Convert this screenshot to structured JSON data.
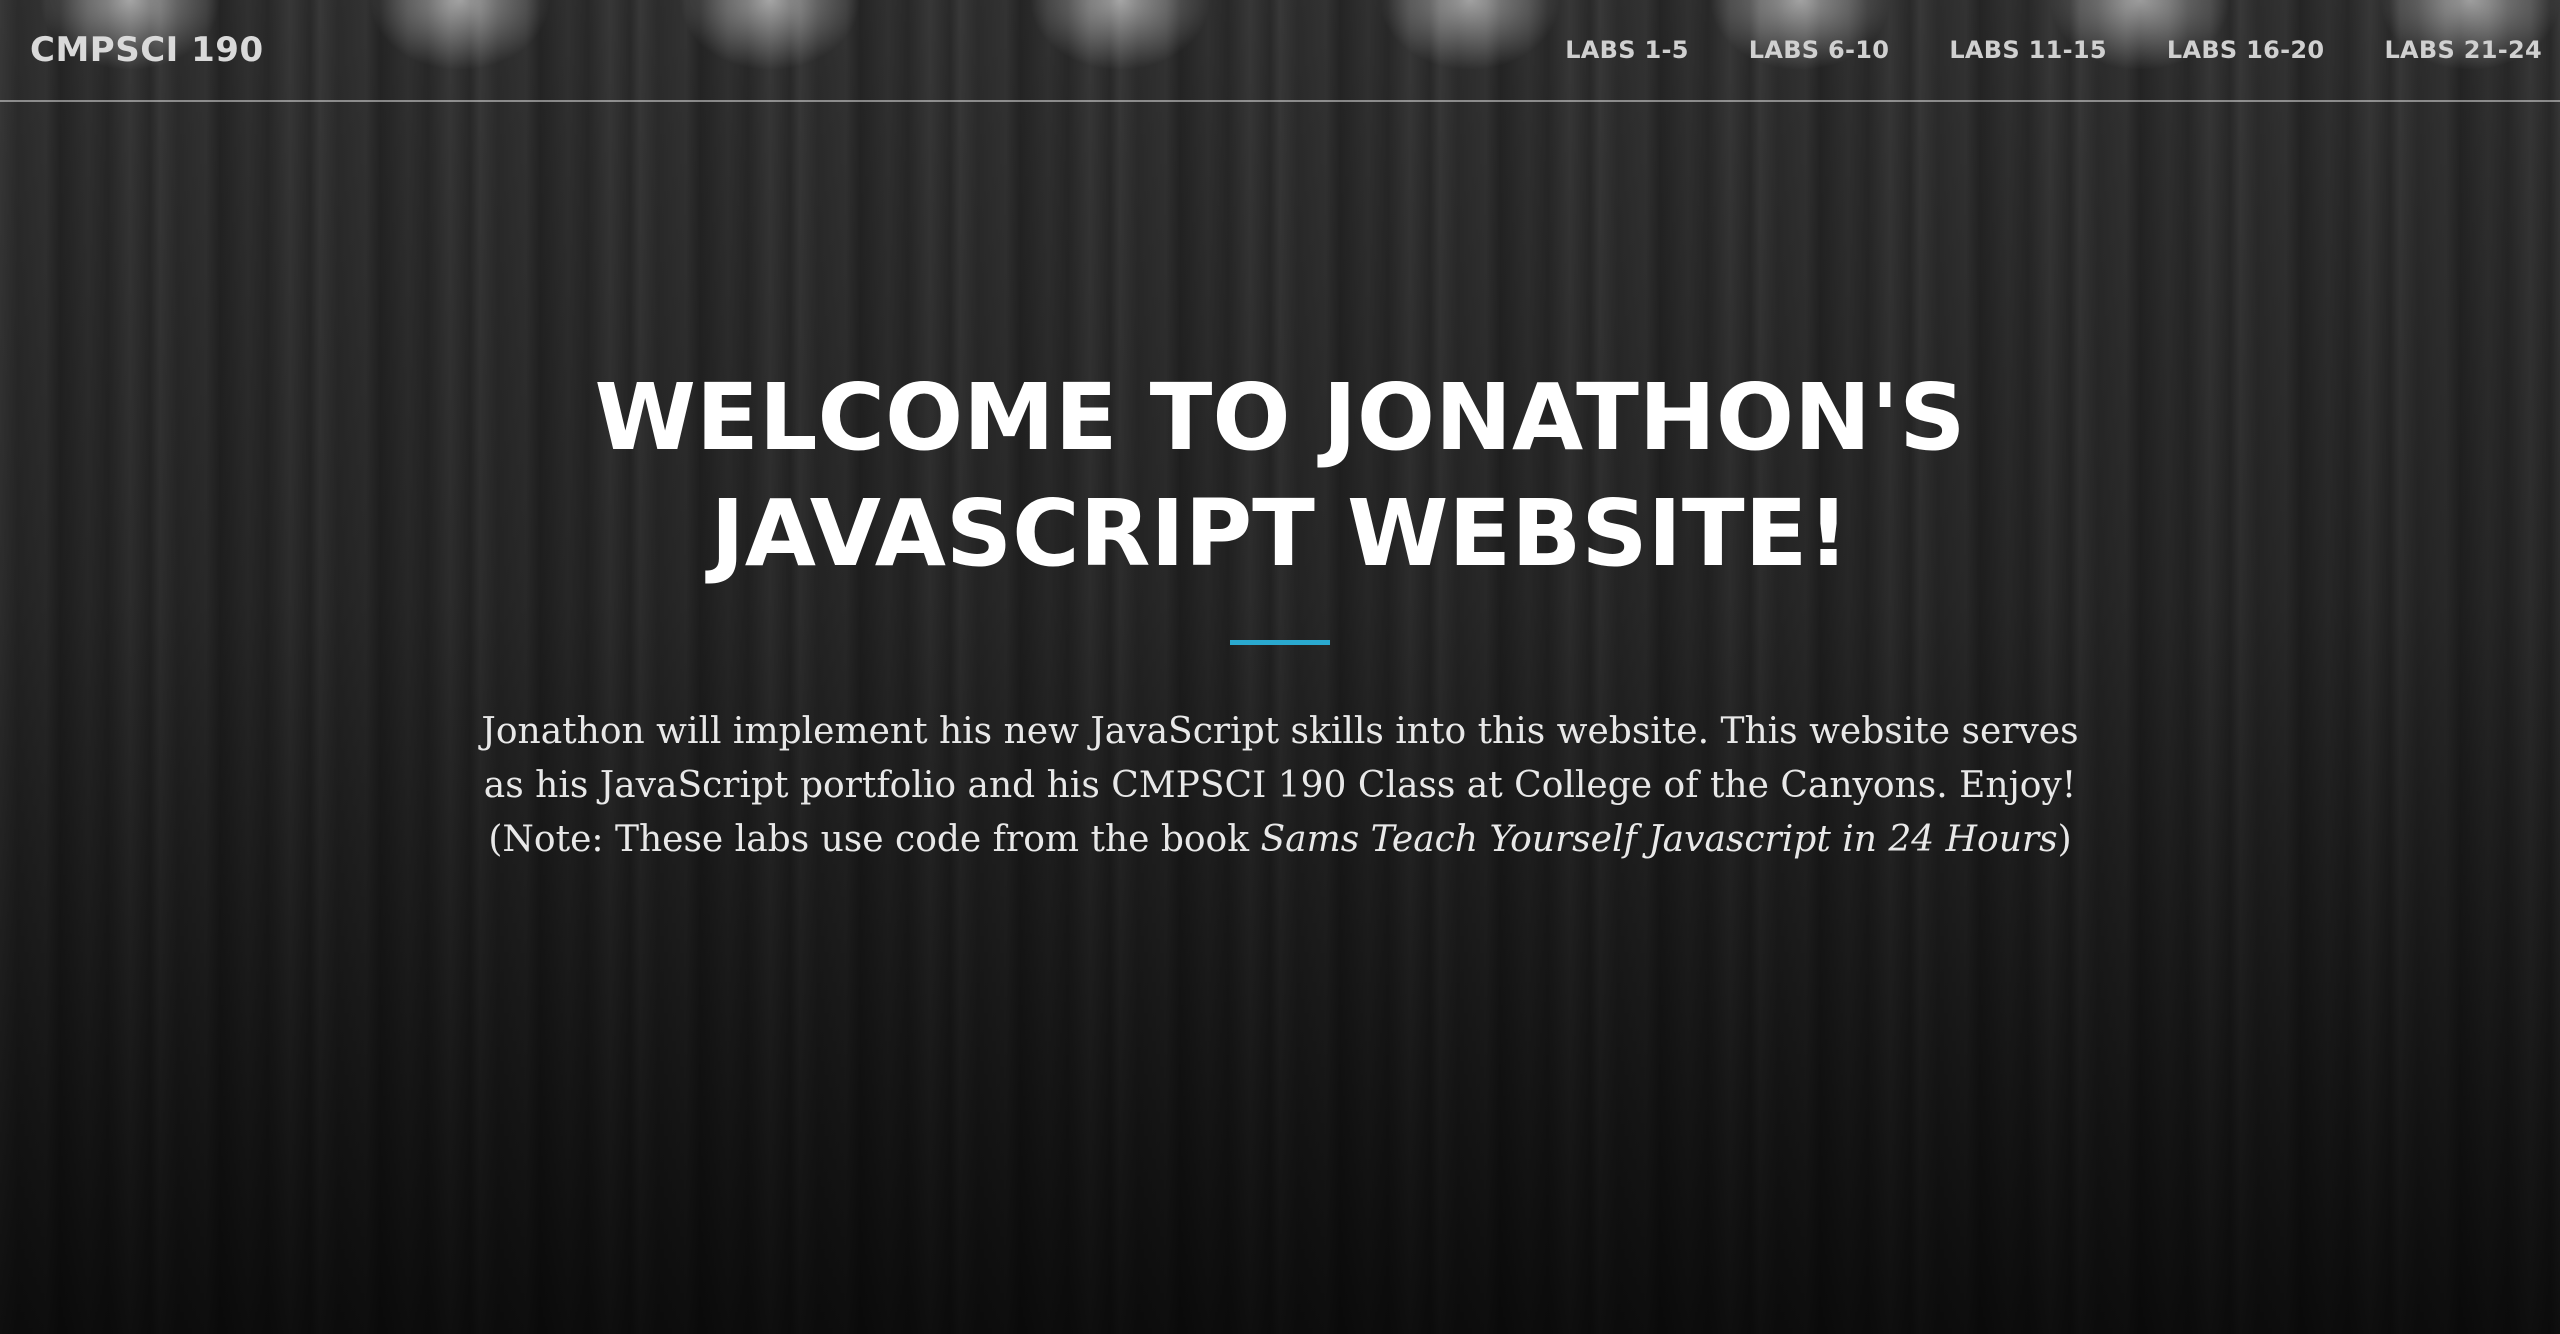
{
  "navbar": {
    "brand": "CMPSCI 190",
    "links": [
      "LABS 1-5",
      "LABS 6-10",
      "LABS 11-15",
      "LABS 16-20",
      "LABS 21-24"
    ]
  },
  "hero": {
    "title": "WELCOME TO JONATHON'S JAVASCRIPT WEBSITE!",
    "paragraph": "Jonathon will implement his new JavaScript skills into this website. This website serves as his JavaScript portfolio and his CMPSCI 190 Class at College of the Canyons. Enjoy!",
    "note_prefix": "(Note: These labs use code from the book ",
    "book_title": "Sams Teach Yourself Javascript in 24 Hours",
    "note_suffix": ")"
  },
  "colors": {
    "accent": "#2aa9cf"
  }
}
